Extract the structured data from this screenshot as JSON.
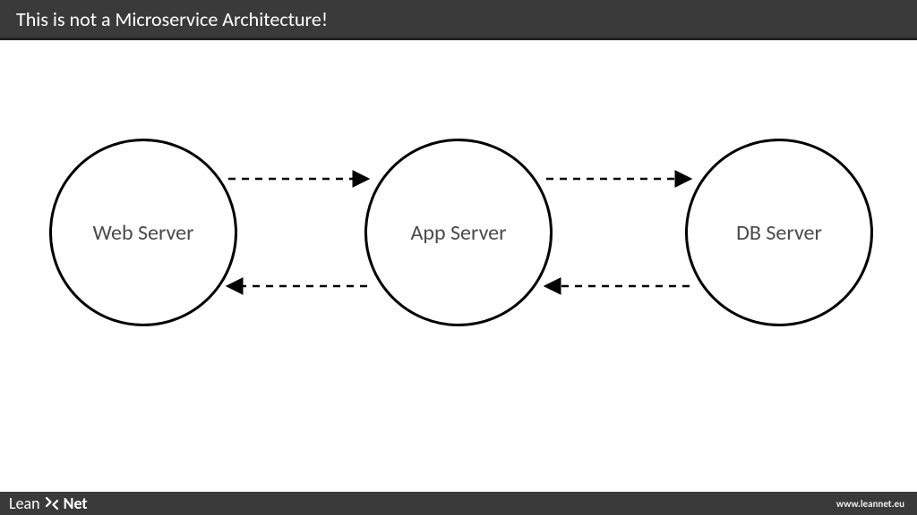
{
  "header": {
    "title": "This is not a Microservice Architecture!"
  },
  "nodes": {
    "web": "Web Server",
    "app": "App Server",
    "db": "DB Server"
  },
  "footer": {
    "brand_left": "Lean",
    "brand_right": "Net",
    "url": "www.leannet.eu"
  }
}
